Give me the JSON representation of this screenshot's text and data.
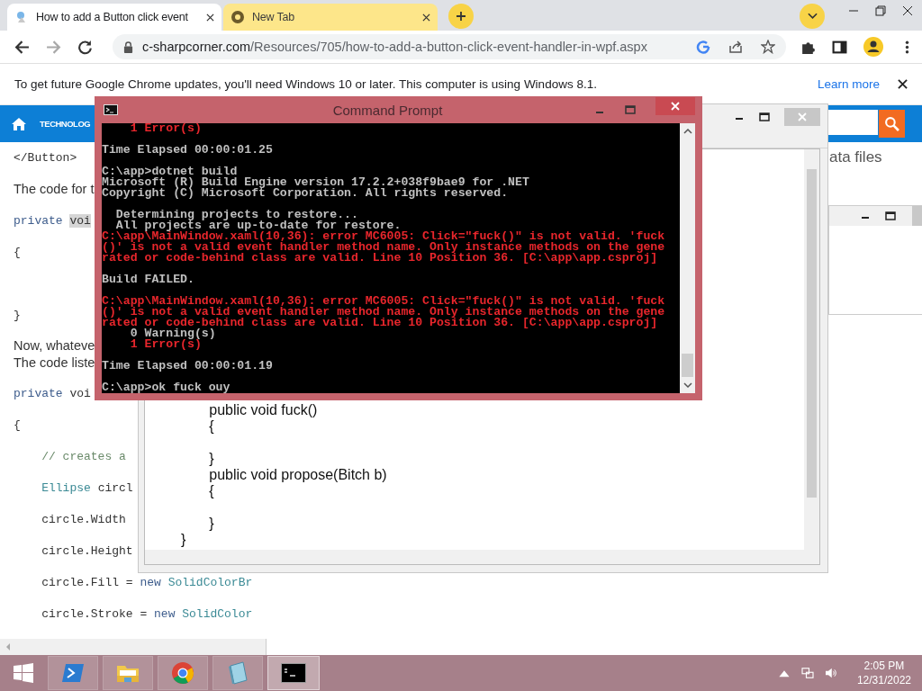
{
  "browser": {
    "tabs": [
      {
        "title": "How to add a Button click event",
        "selected": true
      },
      {
        "title": "New Tab",
        "selected": false
      }
    ],
    "forward": {
      "disabled": true
    },
    "url": {
      "domain": "c-sharpcorner.com",
      "path": "/Resources/705/how-to-add-a-button-click-event-handler-in-wpf.aspx"
    },
    "infobar": {
      "message": "To get future Google Chrome updates, you'll need Windows 10 or later. This computer is using Windows 8.1.",
      "link": "Learn more"
    }
  },
  "page": {
    "nav": {
      "label": "TECHNOLOG"
    },
    "lines": [
      {
        "kind": "code",
        "tokens": [
          {
            "text": "</Button>",
            "kind": "plain"
          }
        ]
      },
      {
        "kind": "prose",
        "lines": [
          "The code for t"
        ]
      },
      {
        "kind": "code",
        "tokens": [
          {
            "text": "private ",
            "kind": "keyword"
          },
          {
            "text": "voi",
            "kind": "highlight"
          }
        ]
      },
      {
        "kind": "code",
        "tokens": [
          {
            "text": "{",
            "kind": "plain"
          }
        ]
      },
      {
        "kind": "code",
        "tokens": [
          {
            "text": "}",
            "kind": "plain"
          }
        ]
      },
      {
        "kind": "prose",
        "lines": [
          "Now, whateve",
          "The code liste"
        ]
      },
      {
        "kind": "code",
        "tokens": [
          {
            "text": "private",
            "kind": "keyword"
          },
          {
            "text": " voi",
            "kind": "plain"
          }
        ]
      },
      {
        "kind": "code",
        "tokens": [
          {
            "text": "{",
            "kind": "plain"
          }
        ]
      },
      {
        "kind": "code",
        "tokens": [
          {
            "text": "    // creates a",
            "kind": "comment"
          }
        ]
      },
      {
        "kind": "code",
        "tokens": [
          {
            "text": "    Ellipse",
            "kind": "type"
          },
          {
            "text": " circl",
            "kind": "plain"
          }
        ]
      },
      {
        "kind": "code",
        "tokens": [
          {
            "text": "    circle.Width",
            "kind": "plain"
          }
        ]
      },
      {
        "kind": "code",
        "tokens": [
          {
            "text": "    circle.Height",
            "kind": "plain"
          }
        ]
      },
      {
        "kind": "code",
        "tokens": [
          {
            "text": "    circle.Fill = ",
            "kind": "plain"
          },
          {
            "text": "new ",
            "kind": "keyword"
          },
          {
            "text": "SolidColorBr",
            "kind": "type"
          }
        ]
      },
      {
        "kind": "code",
        "tokens": [
          {
            "text": "    circle.Stroke = ",
            "kind": "plain"
          },
          {
            "text": "new ",
            "kind": "keyword"
          },
          {
            "text": "SolidColor",
            "kind": "type"
          }
        ]
      }
    ],
    "side_text": "ata files"
  },
  "editor": {
    "blocks": [
      [
        "              public void fuck()",
        "              {"
      ],
      [
        "              }",
        "              public void propose(Bitch b)",
        "              {"
      ],
      [
        "              }",
        "       }"
      ]
    ]
  },
  "console": {
    "title": "Command Prompt",
    "blocks": [
      [
        {
          "text": "    1 Error(s)",
          "error": true
        }
      ],
      [
        {
          "text": "Time Elapsed 00:00:01.25",
          "error": false
        }
      ],
      [
        {
          "text": "C:\\app>dotnet build",
          "error": false
        },
        {
          "text": "Microsoft (R) Build Engine version 17.2.2+038f9bae9 for .NET",
          "error": false
        },
        {
          "text": "Copyright (C) Microsoft Corporation. All rights reserved.",
          "error": false
        }
      ],
      [
        {
          "text": "  Determining projects to restore...",
          "error": false
        },
        {
          "text": "  All projects are up-to-date for restore.",
          "error": false
        },
        {
          "text": "C:\\app\\MainWindow.xaml(10,36): error MC6005: Click=\"fuck()\" is not valid. 'fuck",
          "error": true
        },
        {
          "text": "()' is not a valid event handler method name. Only instance methods on the gene",
          "error": true
        },
        {
          "text": "rated or code-behind class are valid. Line 10 Position 36. [C:\\app\\app.csproj]",
          "error": true
        }
      ],
      [
        {
          "text": "Build FAILED.",
          "error": false
        }
      ],
      [
        {
          "text": "C:\\app\\MainWindow.xaml(10,36): error MC6005: Click=\"fuck()\" is not valid. 'fuck",
          "error": true
        },
        {
          "text": "()' is not a valid event handler method name. Only instance methods on the gene",
          "error": true
        },
        {
          "text": "rated or code-behind class are valid. Line 10 Position 36. [C:\\app\\app.csproj]",
          "error": true
        },
        {
          "text": "    0 Warning(s)",
          "error": false
        },
        {
          "text": "    1 Error(s)",
          "error": true
        }
      ],
      [
        {
          "text": "Time Elapsed 00:00:01.19",
          "error": false
        }
      ],
      [
        {
          "text": "C:\\app>ok fuck ouy",
          "error": false
        }
      ]
    ]
  },
  "taskbar": {
    "apps": [
      {
        "kind": "powershell",
        "selected": false
      },
      {
        "kind": "explorer",
        "selected": false
      },
      {
        "kind": "chrome",
        "selected": false
      },
      {
        "kind": "notepad",
        "selected": false
      },
      {
        "kind": "cmd",
        "selected": true
      }
    ],
    "time": "2:05 PM",
    "date": "12/31/2022"
  }
}
